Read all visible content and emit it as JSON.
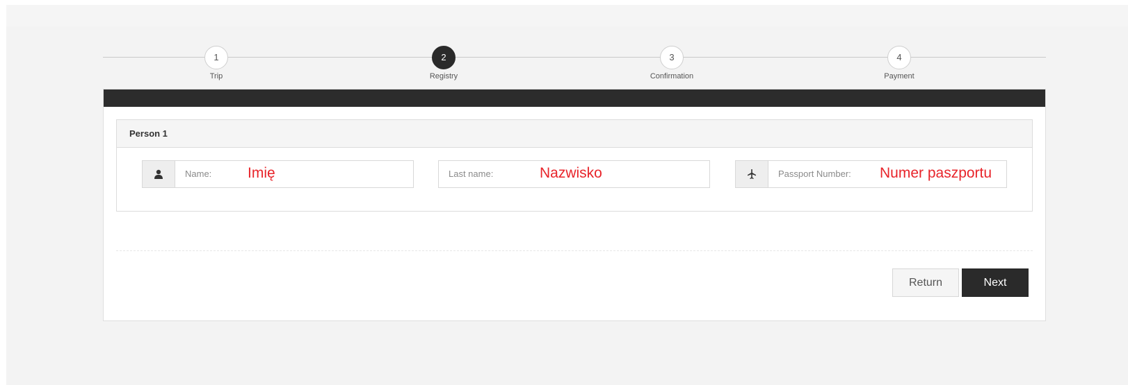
{
  "steps": [
    {
      "number": "1",
      "label": "Trip"
    },
    {
      "number": "2",
      "label": "Registry"
    },
    {
      "number": "3",
      "label": "Confirmation"
    },
    {
      "number": "4",
      "label": "Payment"
    }
  ],
  "active_step": "2",
  "person": {
    "title": "Person 1",
    "fields": {
      "name": {
        "label": "Name:",
        "value": "Imię",
        "icon": "user-icon"
      },
      "last_name": {
        "label": "Last name:",
        "value": "Nazwisko"
      },
      "passport": {
        "label": "Passport Number:",
        "value": "Numer paszportu",
        "icon": "plane-icon"
      }
    }
  },
  "buttons": {
    "return_label": "Return",
    "next_label": "Next"
  },
  "colors": {
    "accent": "#2a2a2a",
    "value_text": "#e8242a"
  }
}
